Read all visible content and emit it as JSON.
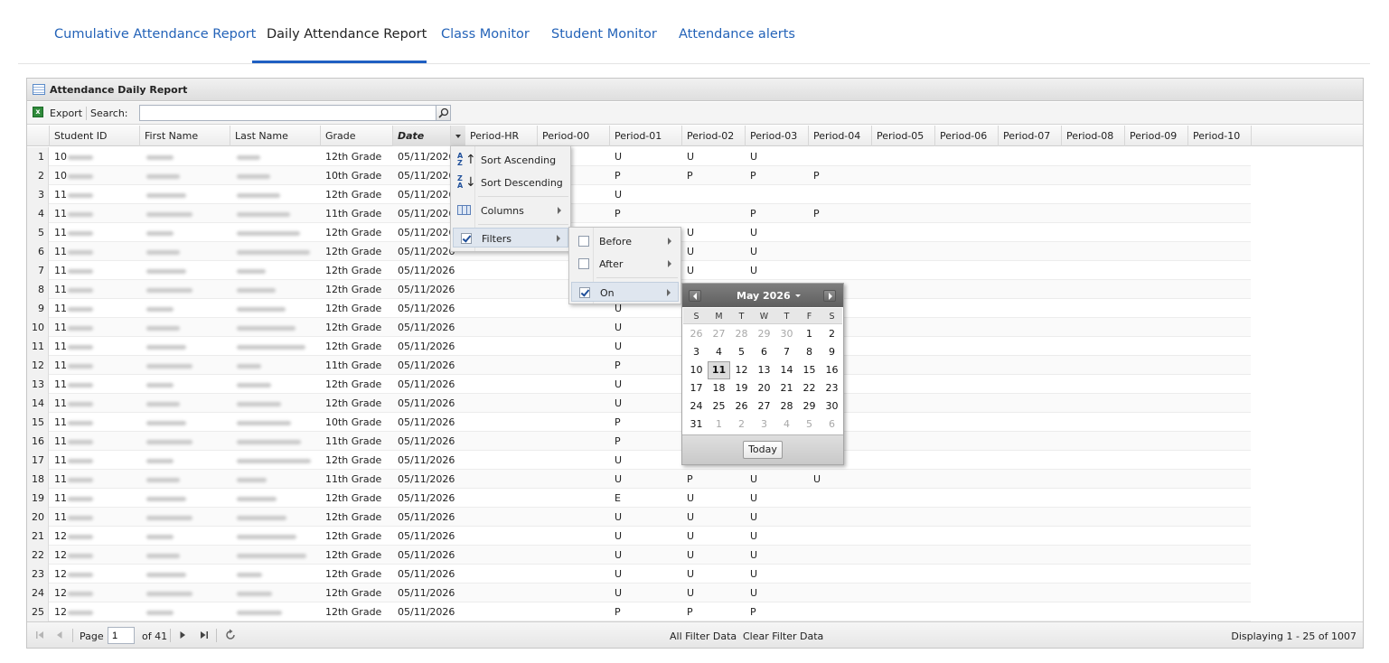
{
  "tabs": [
    {
      "label": "Cumulative Attendance Report"
    },
    {
      "label": "Daily Attendance Report"
    },
    {
      "label": "Class Monitor"
    },
    {
      "label": "Student Monitor"
    },
    {
      "label": "Attendance alerts"
    }
  ],
  "active_tab": "Daily Attendance Report",
  "panel": {
    "title": "Attendance Daily Report"
  },
  "toolbar": {
    "export_label": "Export",
    "search_label": "Search:",
    "search_value": ""
  },
  "columns": [
    "Student ID",
    "First Name",
    "Last Name",
    "Grade",
    "Date",
    "Period-HR",
    "Period-00",
    "Period-01",
    "Period-02",
    "Period-03",
    "Period-04",
    "Period-05",
    "Period-06",
    "Period-07",
    "Period-08",
    "Period-09",
    "Period-10"
  ],
  "rows": [
    {
      "n": "1",
      "id": "10",
      "grade": "12th Grade",
      "date": "05/11/2026",
      "p01": "U",
      "p02": "U",
      "p03": "U",
      "p04": ""
    },
    {
      "n": "2",
      "id": "10",
      "grade": "10th Grade",
      "date": "05/11/2026",
      "p01": "P",
      "p02": "P",
      "p03": "P",
      "p04": "P"
    },
    {
      "n": "3",
      "id": "11",
      "grade": "12th Grade",
      "date": "05/11/2026",
      "p01": "U",
      "p02": "",
      "p03": "",
      "p04": ""
    },
    {
      "n": "4",
      "id": "11",
      "grade": "11th Grade",
      "date": "05/11/2026",
      "p01": "P",
      "p02": "",
      "p03": "P",
      "p04": "P"
    },
    {
      "n": "5",
      "id": "11",
      "grade": "12th Grade",
      "date": "05/11/2026",
      "p01": "",
      "p02": "U",
      "p03": "U",
      "p04": ""
    },
    {
      "n": "6",
      "id": "11",
      "grade": "12th Grade",
      "date": "05/11/2026",
      "p01": "",
      "p02": "U",
      "p03": "U",
      "p04": ""
    },
    {
      "n": "7",
      "id": "11",
      "grade": "12th Grade",
      "date": "05/11/2026",
      "p01": "",
      "p02": "U",
      "p03": "U",
      "p04": ""
    },
    {
      "n": "8",
      "id": "11",
      "grade": "12th Grade",
      "date": "05/11/2026",
      "p01": "",
      "p02": "",
      "p03": "",
      "p04": ""
    },
    {
      "n": "9",
      "id": "11",
      "grade": "12th Grade",
      "date": "05/11/2026",
      "p01": "U",
      "p02": "",
      "p03": "",
      "p04": ""
    },
    {
      "n": "10",
      "id": "11",
      "grade": "12th Grade",
      "date": "05/11/2026",
      "p01": "U",
      "p02": "",
      "p03": "",
      "p04": ""
    },
    {
      "n": "11",
      "id": "11",
      "grade": "12th Grade",
      "date": "05/11/2026",
      "p01": "U",
      "p02": "",
      "p03": "",
      "p04": ""
    },
    {
      "n": "12",
      "id": "11",
      "grade": "11th Grade",
      "date": "05/11/2026",
      "p01": "P",
      "p02": "",
      "p03": "",
      "p04": ""
    },
    {
      "n": "13",
      "id": "11",
      "grade": "12th Grade",
      "date": "05/11/2026",
      "p01": "U",
      "p02": "",
      "p03": "",
      "p04": ""
    },
    {
      "n": "14",
      "id": "11",
      "grade": "12th Grade",
      "date": "05/11/2026",
      "p01": "U",
      "p02": "",
      "p03": "",
      "p04": ""
    },
    {
      "n": "15",
      "id": "11",
      "grade": "10th Grade",
      "date": "05/11/2026",
      "p01": "P",
      "p02": "",
      "p03": "",
      "p04": ""
    },
    {
      "n": "16",
      "id": "11",
      "grade": "11th Grade",
      "date": "05/11/2026",
      "p01": "P",
      "p02": "",
      "p03": "",
      "p04": ""
    },
    {
      "n": "17",
      "id": "11",
      "grade": "12th Grade",
      "date": "05/11/2026",
      "p01": "U",
      "p02": "",
      "p03": "",
      "p04": ""
    },
    {
      "n": "18",
      "id": "11",
      "grade": "11th Grade",
      "date": "05/11/2026",
      "p01": "U",
      "p02": "P",
      "p03": "U",
      "p04": "U"
    },
    {
      "n": "19",
      "id": "11",
      "grade": "12th Grade",
      "date": "05/11/2026",
      "p01": "E",
      "p02": "U",
      "p03": "U",
      "p04": ""
    },
    {
      "n": "20",
      "id": "11",
      "grade": "12th Grade",
      "date": "05/11/2026",
      "p01": "U",
      "p02": "U",
      "p03": "U",
      "p04": ""
    },
    {
      "n": "21",
      "id": "12",
      "grade": "12th Grade",
      "date": "05/11/2026",
      "p01": "U",
      "p02": "U",
      "p03": "U",
      "p04": ""
    },
    {
      "n": "22",
      "id": "12",
      "grade": "12th Grade",
      "date": "05/11/2026",
      "p01": "U",
      "p02": "U",
      "p03": "U",
      "p04": ""
    },
    {
      "n": "23",
      "id": "12",
      "grade": "12th Grade",
      "date": "05/11/2026",
      "p01": "U",
      "p02": "U",
      "p03": "U",
      "p04": ""
    },
    {
      "n": "24",
      "id": "12",
      "grade": "12th Grade",
      "date": "05/11/2026",
      "p01": "U",
      "p02": "U",
      "p03": "U",
      "p04": ""
    },
    {
      "n": "25",
      "id": "12",
      "grade": "12th Grade",
      "date": "05/11/2026",
      "p01": "P",
      "p02": "P",
      "p03": "P",
      "p04": ""
    }
  ],
  "column_menu": {
    "sort_asc": "Sort Ascending",
    "sort_desc": "Sort Descending",
    "columns": "Columns",
    "filters": "Filters"
  },
  "filter_menu": {
    "before": "Before",
    "after": "After",
    "on": "On"
  },
  "datepicker": {
    "month_label": "May 2026",
    "dow": [
      "S",
      "M",
      "T",
      "W",
      "T",
      "F",
      "S"
    ],
    "weeks": [
      [
        "26",
        "27",
        "28",
        "29",
        "30",
        "1",
        "2"
      ],
      [
        "3",
        "4",
        "5",
        "6",
        "7",
        "8",
        "9"
      ],
      [
        "10",
        "11",
        "12",
        "13",
        "14",
        "15",
        "16"
      ],
      [
        "17",
        "18",
        "19",
        "20",
        "21",
        "22",
        "23"
      ],
      [
        "24",
        "25",
        "26",
        "27",
        "28",
        "29",
        "30"
      ],
      [
        "31",
        "1",
        "2",
        "3",
        "4",
        "5",
        "6"
      ]
    ],
    "selected": "11",
    "today_label": "Today"
  },
  "pager": {
    "page_label": "Page",
    "page_value": "1",
    "of_label": "of 41",
    "all_filter": "All Filter Data",
    "clear_filter": "Clear Filter Data",
    "displaying": "Displaying 1 - 25 of 1007"
  },
  "colors": {
    "link": "#2463b8",
    "tab_underline": "#1f5fc2",
    "header_bg": "#dedede"
  }
}
